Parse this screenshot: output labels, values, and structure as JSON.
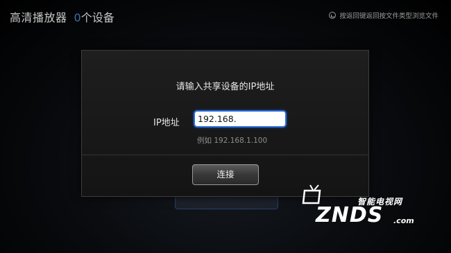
{
  "header": {
    "app_title": "高清播放器",
    "device_count": "0",
    "device_label": "个设备",
    "hint": "按返回键返回按文件类型浏览文件"
  },
  "dialog": {
    "title": "请输入共享设备的IP地址",
    "ip_label": "IP地址",
    "ip_value": "192.168.",
    "example": "例如 192.168.1.100",
    "connect_label": "连接"
  },
  "watermark": {
    "top": "智能电视网",
    "main": "ZNDS",
    "suffix": ".com"
  },
  "colors": {
    "accent": "#2c6ed8",
    "device_count": "#3b6ea8"
  }
}
